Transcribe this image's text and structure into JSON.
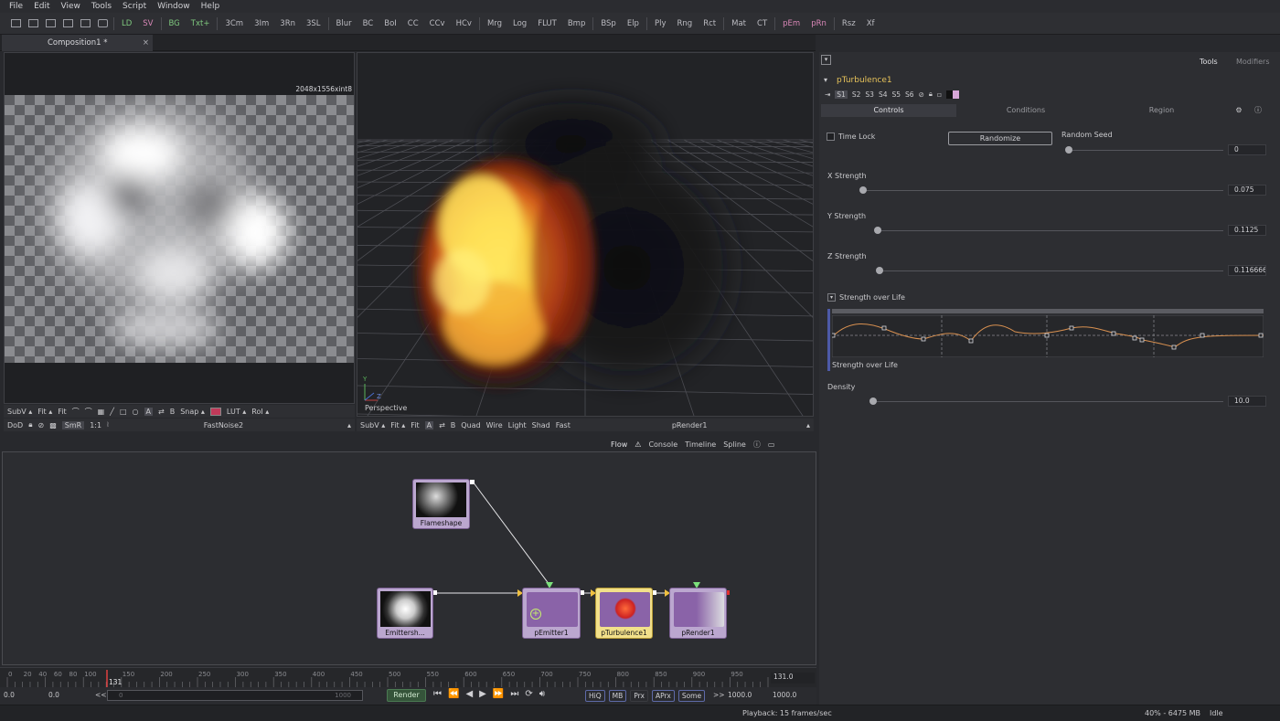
{
  "menu": [
    "File",
    "Edit",
    "View",
    "Tools",
    "Script",
    "Window",
    "Help"
  ],
  "toolbar_tools": [
    {
      "label": "LD",
      "color": "green"
    },
    {
      "label": "SV",
      "color": "pink"
    },
    {
      "label": "BG",
      "color": "green"
    },
    {
      "label": "Txt+",
      "color": "green"
    },
    {
      "label": "3Cm"
    },
    {
      "label": "3Im"
    },
    {
      "label": "3Rn"
    },
    {
      "label": "3SL"
    },
    {
      "label": "Blur"
    },
    {
      "label": "BC"
    },
    {
      "label": "BoI"
    },
    {
      "label": "CC"
    },
    {
      "label": "CCv"
    },
    {
      "label": "HCv"
    },
    {
      "label": "Mrg"
    },
    {
      "label": "Log"
    },
    {
      "label": "FLUT"
    },
    {
      "label": "Bmp"
    },
    {
      "label": "BSp"
    },
    {
      "label": "Elp"
    },
    {
      "label": "Ply"
    },
    {
      "label": "Rng"
    },
    {
      "label": "Rct"
    },
    {
      "label": "Mat"
    },
    {
      "label": "CT"
    },
    {
      "label": "pEm",
      "color": "pink"
    },
    {
      "label": "pRn",
      "color": "pink"
    },
    {
      "label": "Rsz"
    },
    {
      "label": "Xf"
    }
  ],
  "composition_tab": {
    "label": "Composition1 *",
    "close": "×"
  },
  "left_viewer": {
    "resolution": "2048x1556xint8",
    "toolbar1": [
      "SubV ▴",
      "Fit ▴",
      "Fit",
      "Snap ▴",
      "LUT ▴",
      "RoI ▴"
    ],
    "toolbar1_letters": [
      "A",
      "B"
    ],
    "toolbar2": {
      "dod": "DoD",
      "smr": "SmR",
      "ratio": "1:1",
      "node_name": "FastNoise2"
    }
  },
  "right_viewer": {
    "view_label": "Perspective",
    "axis_y": "Y",
    "axis_z": "Z",
    "toolbar": [
      "SubV ▴",
      "Fit ▴",
      "Fit",
      "A",
      "B",
      "Quad",
      "Wire",
      "Light",
      "Shad",
      "Fast"
    ],
    "node_name": "pRender1"
  },
  "flow_tabs": [
    "Flow",
    "Console",
    "Timeline",
    "Spline"
  ],
  "nodes": [
    {
      "label": "Flameshape"
    },
    {
      "label": "Emittersh..."
    },
    {
      "label": "pEmitter1"
    },
    {
      "label": "pTurbulence1"
    },
    {
      "label": "pRender1"
    }
  ],
  "inspector": {
    "top_tabs": [
      "Tools",
      "Modifiers"
    ],
    "tool_name": "pTurbulence1",
    "version_buttons": [
      "S1",
      "S2",
      "S3",
      "S4",
      "S5",
      "S6"
    ],
    "section_tabs": [
      "Controls",
      "Conditions",
      "Region"
    ],
    "time_lock": "Time Lock",
    "randomize": "Randomize",
    "random_seed": {
      "label": "Random Seed",
      "value": "0"
    },
    "x_strength": {
      "label": "X Strength",
      "value": "0.075"
    },
    "y_strength": {
      "label": "Y Strength",
      "value": "0.1125"
    },
    "z_strength": {
      "label": "Z Strength",
      "value": "0.116666"
    },
    "strength_over_life": "Strength over Life",
    "strength_over_life_caption": "Strength over Life",
    "density": {
      "label": "Density",
      "value": "10.0"
    }
  },
  "timeline": {
    "ticks": [
      "0",
      "20",
      "40",
      "60",
      "80",
      "100",
      "150",
      "200",
      "250",
      "300",
      "350",
      "400",
      "450",
      "500",
      "550",
      "600",
      "650",
      "700",
      "750",
      "800",
      "850",
      "900",
      "950"
    ],
    "current_frame": "131",
    "end_value": "131.0"
  },
  "transport": {
    "start": "0.0",
    "render_start": "0.0",
    "prev": "<<",
    "range_start": "0",
    "range_end": "1000",
    "render": "Render",
    "buttons": [
      "HiQ",
      "MB",
      "Prx",
      "APrx",
      "Some"
    ],
    "next": ">>",
    "render_end": "1000.0",
    "end": "1000.0"
  },
  "status": {
    "playback": "Playback: 15 frames/sec",
    "memory": "40% - 6475 MB",
    "state": "Idle"
  },
  "colors": {
    "node_purple": "#bba7cf",
    "node_yellow": "#f2e08a",
    "accent_green": "#7fc97f",
    "accent_pink": "#d987b7",
    "inspector_yellow": "#e6c25a"
  }
}
